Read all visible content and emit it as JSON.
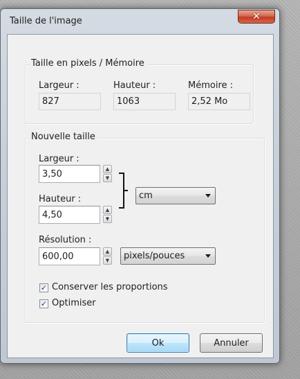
{
  "window": {
    "title": "Taille de l'image",
    "close_glyph": "✕"
  },
  "pixels_group": {
    "title": "Taille en pixels / Mémoire",
    "width_label": "Largeur :",
    "width_value": "827",
    "height_label": "Hauteur :",
    "height_value": "1063",
    "memory_label": "Mémoire :",
    "memory_value": "2,52 Mo"
  },
  "new_size_group": {
    "title": "Nouvelle taille",
    "width_label": "Largeur :",
    "width_value": "3,50",
    "height_label": "Hauteur :",
    "height_value": "4,50",
    "unit_selected": "cm",
    "resolution_label": "Résolution :",
    "resolution_value": "600,00",
    "resolution_unit_selected": "pixels/pouces"
  },
  "options": {
    "keep_proportions_label": "Conserver les proportions",
    "keep_proportions_checked": true,
    "optimize_label": "Optimiser",
    "optimize_checked": true,
    "check_glyph": "✓"
  },
  "buttons": {
    "ok_label": "Ok",
    "cancel_label": "Annuler"
  },
  "icons": {
    "spin_up": "▲",
    "spin_down": "▼"
  },
  "colors": {
    "title_bar": "#cfd6df",
    "close_button": "#c8432a",
    "default_button": "#bee6fd",
    "dialog_background": "#f0f0f0"
  }
}
